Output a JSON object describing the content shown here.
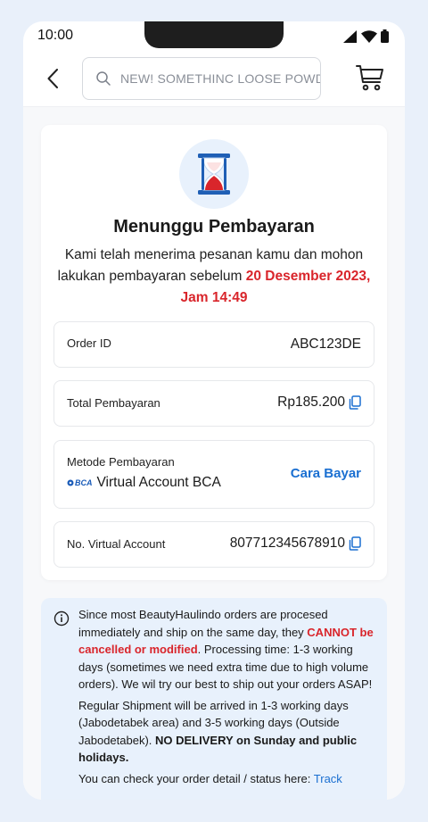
{
  "status_bar": {
    "time": "10:00"
  },
  "header": {
    "search_placeholder": "NEW! SOMETHINC LOOSE POWDE..."
  },
  "payment": {
    "title": "Menunggu Pembayaran",
    "description": "Kami telah menerima pesanan kamu dan mohon lakukan pembayaran sebelum ",
    "deadline": "20 Desember 2023, Jam 14:49",
    "order_id_label": "Order ID",
    "order_id_value": "ABC123DE",
    "total_label": "Total Pembayaran",
    "total_value": "Rp185.200",
    "method_label": "Metode Pembayaran",
    "bank_logo": "BCA",
    "method_value": "Virtual Account BCA",
    "how_to_pay": "Cara Bayar",
    "va_label": "No. Virtual Account",
    "va_value": "807712345678910"
  },
  "info": {
    "p1_a": "Since most BeautyHaulindo orders are procesed immediately and ship on the same day, they ",
    "p1_b": "CANNOT be cancelled or modified",
    "p1_c": ". Processing time: 1-3 working days (sometimes we need extra time due to high volume orders). We wil try our best to ship out your orders ASAP!",
    "p2_a": "Regular Shipment will be arrived in 1-3 working days (Jabodetabek area) and 3-5 working days (Outside Jabodetabek). ",
    "p2_b": "NO DELIVERY on Sunday and public holidays.",
    "p3_a": "You can check your order detail / status here: ",
    "p3_link": "Track"
  },
  "colors": {
    "accent_blue": "#1a6fd1",
    "alert_red": "#d9252b",
    "info_bg": "#e8f1fc"
  },
  "icons": [
    "signal-icon",
    "wifi-icon",
    "battery-icon",
    "back-arrow-icon",
    "search-icon",
    "cart-icon",
    "hourglass-icon",
    "copy-icon",
    "info-icon"
  ]
}
